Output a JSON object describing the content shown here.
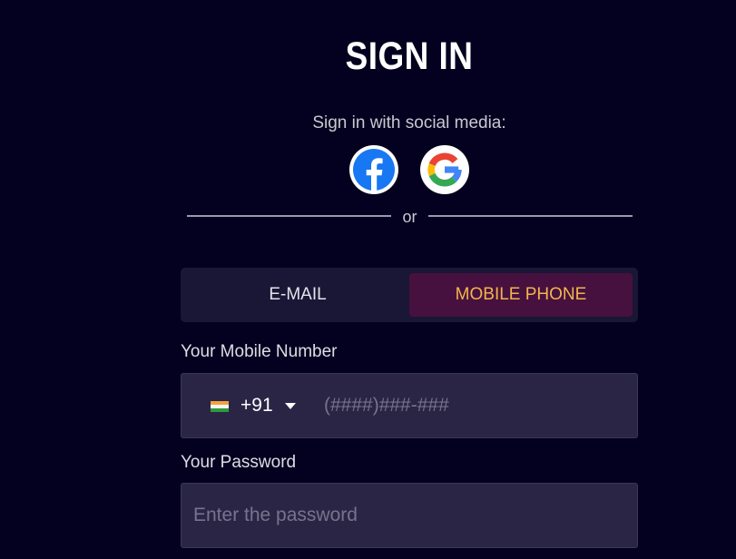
{
  "header": {
    "title": "SIGN IN"
  },
  "social": {
    "label": "Sign in with social media:",
    "providers": [
      {
        "name": "Facebook",
        "icon": "facebook-icon",
        "color": "#1877f2"
      },
      {
        "name": "Google",
        "icon": "google-icon",
        "color": "#4285f4"
      }
    ]
  },
  "divider": {
    "text": "or"
  },
  "tabs": [
    {
      "label": "E-MAIL",
      "active": false
    },
    {
      "label": "MOBILE PHONE",
      "active": true
    }
  ],
  "form": {
    "mobile": {
      "label": "Your Mobile Number",
      "country_flag": "india-flag-icon",
      "dial_code": "+91",
      "placeholder": "(####)###-###",
      "value": ""
    },
    "password": {
      "label": "Your Password",
      "placeholder": "Enter the password",
      "value": ""
    }
  },
  "colors": {
    "background": "#04001f",
    "active_tab_bg": "#46113f",
    "active_tab_text": "#f3b44c",
    "input_bg": "#2b2545"
  }
}
